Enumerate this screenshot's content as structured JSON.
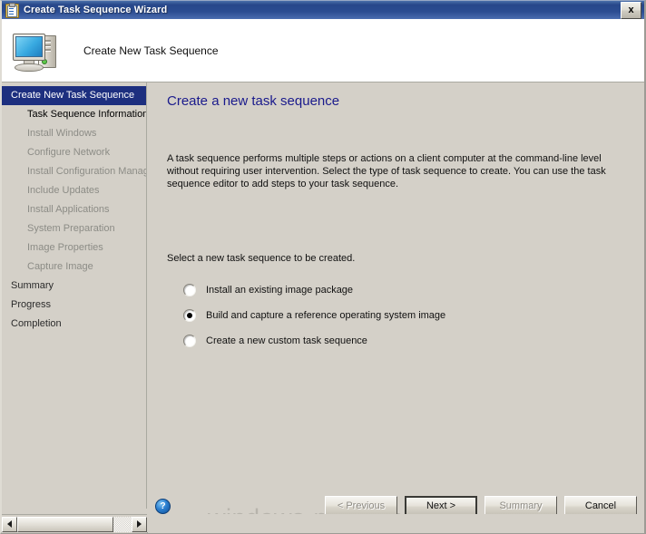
{
  "window": {
    "title": "Create Task Sequence Wizard",
    "title_icon": "clipboard-icon",
    "close_label": "x"
  },
  "header": {
    "icon": "computer-icon",
    "title": "Create New Task Sequence"
  },
  "sidebar": {
    "items": [
      {
        "label": "Create New Task Sequence",
        "state": "selected",
        "indent": false
      },
      {
        "label": "Task Sequence Information",
        "state": "current",
        "indent": true
      },
      {
        "label": "Install Windows",
        "state": "disabled",
        "indent": true
      },
      {
        "label": "Configure Network",
        "state": "disabled",
        "indent": true
      },
      {
        "label": "Install Configuration Manag",
        "state": "disabled",
        "indent": true
      },
      {
        "label": "Include Updates",
        "state": "disabled",
        "indent": true
      },
      {
        "label": "Install Applications",
        "state": "disabled",
        "indent": true
      },
      {
        "label": "System Preparation",
        "state": "disabled",
        "indent": true
      },
      {
        "label": "Image Properties",
        "state": "disabled",
        "indent": true
      },
      {
        "label": "Capture Image",
        "state": "disabled",
        "indent": true
      },
      {
        "label": "Summary",
        "state": "normal",
        "indent": false
      },
      {
        "label": "Progress",
        "state": "normal",
        "indent": false
      },
      {
        "label": "Completion",
        "state": "normal",
        "indent": false
      }
    ]
  },
  "main": {
    "heading": "Create a new task sequence",
    "paragraph": "A task sequence performs multiple steps or actions on a client computer at the command-line level without requiring user intervention. Select the type of task sequence to create. You can use the task sequence editor to add steps to your task sequence.",
    "prompt": "Select a new task sequence to be created.",
    "options": [
      {
        "label": "Install an existing image package",
        "selected": false
      },
      {
        "label": "Build and capture a reference operating system image",
        "selected": true
      },
      {
        "label": "Create a new custom task sequence",
        "selected": false
      }
    ]
  },
  "footer": {
    "help_icon": "help-question-icon",
    "help_glyph": "?",
    "watermark": "windows-noob.com",
    "buttons": [
      {
        "label": "< Previous",
        "state": "disabled"
      },
      {
        "label": "Next >",
        "state": "default"
      },
      {
        "label": "Summary",
        "state": "disabled"
      },
      {
        "label": "Cancel",
        "state": "enabled"
      }
    ]
  },
  "scrollbar": {
    "left_arrow": "scroll-left-arrow-icon",
    "right_arrow": "scroll-right-arrow-icon"
  },
  "colors": {
    "titlebar": "#27478a",
    "selection": "#1d2f7f",
    "heading": "#1a1a8c",
    "face": "#d4d0c8",
    "watermark": "#b7b4ac"
  }
}
